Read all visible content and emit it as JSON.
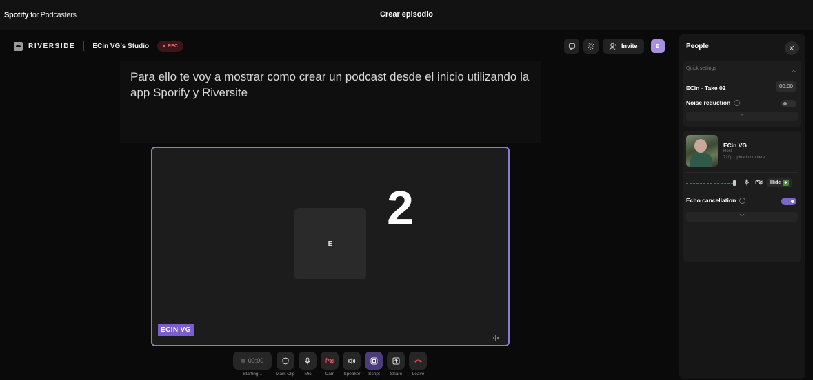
{
  "spotify": {
    "brand_bold": "Spotify",
    "brand_rest": "for Podcasters",
    "title": "Crear episodio"
  },
  "riverside": {
    "wordmark": "RIVERSIDE",
    "studio_name": "ECin VG's Studio",
    "rec_label": "REC",
    "invite_label": "Invite",
    "user_initial": "E",
    "icons": [
      "chat-icon",
      "gear-icon",
      "add-user-icon"
    ]
  },
  "script": {
    "text": "Para ello te voy a mostrar como crear un podcast desde el inicio utilizando la app Sporify y Riversite"
  },
  "tile": {
    "placeholder_initial": "E",
    "countdown": "2",
    "name_tag": "ECIN VG"
  },
  "controls": [
    {
      "name": "timer",
      "label": "Starting...",
      "value": "00:00",
      "icon": "record-icon"
    },
    {
      "name": "mark-clip",
      "label": "Mark Clip",
      "icon": "shield-icon"
    },
    {
      "name": "mic",
      "label": "Mic",
      "icon": "mic-icon"
    },
    {
      "name": "cam",
      "label": "Cam",
      "icon": "camera-off-icon"
    },
    {
      "name": "speaker",
      "label": "Speaker",
      "icon": "speaker-icon"
    },
    {
      "name": "script",
      "label": "Script",
      "icon": "script-icon"
    },
    {
      "name": "share",
      "label": "Share",
      "icon": "share-icon"
    },
    {
      "name": "leave",
      "label": "Leave",
      "icon": "phone-hangup-icon"
    }
  ],
  "people": {
    "title": "People",
    "quick_settings": {
      "heading": "Quick settings",
      "take_name": "ECin - Take 02",
      "take_time": "00:00",
      "noise_reduction_label": "Noise reduction",
      "noise_reduction_on": false
    },
    "person": {
      "name": "ECin VG",
      "role": "Host",
      "status": "720p  Upload complete",
      "hide_label": "Hide",
      "echo_label": "Echo cancellation",
      "echo_on": true
    }
  },
  "colors": {
    "accent": "#8b7bd8",
    "name_tag": "#7c5ccf",
    "leave": "#e04848"
  }
}
